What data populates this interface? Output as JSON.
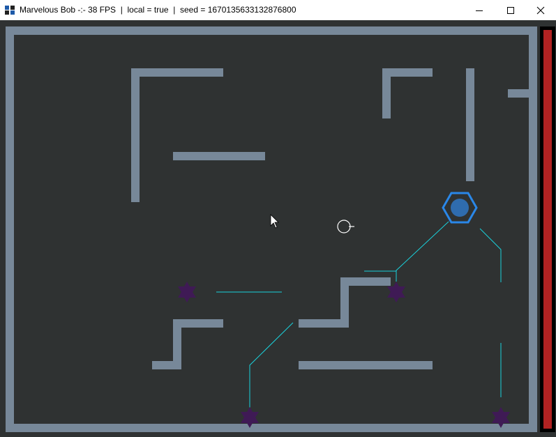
{
  "window": {
    "app_name": "Marvelous Bob",
    "title": "Marvelous Bob -:- 38 FPS  |  local = true  |  seed = 1670135633132876800",
    "fps": 38,
    "local": true,
    "seed": "1670135633132876800",
    "controls": [
      "minimize-icon",
      "maximize-icon",
      "close-icon"
    ]
  },
  "game": {
    "colors": {
      "background": "#2f3232",
      "walls": "#778899",
      "player": "#2f6cae",
      "player_outline": "#2a87e8",
      "enemies": "#3f1a55",
      "lasers": "#1ad2dc",
      "health_bar": "#b22222",
      "health_frame": "#000000",
      "crosshair": "#ffffff"
    },
    "health_fraction": 1.0,
    "enemy_count": 4
  }
}
